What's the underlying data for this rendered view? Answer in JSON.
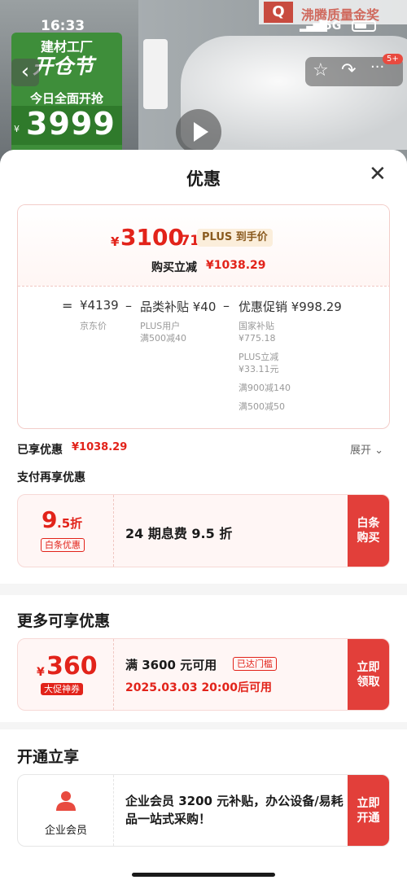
{
  "status_bar": {
    "time": "16:33",
    "network": "5G"
  },
  "promo": {
    "line1": "建材工厂",
    "line2": "开仓节",
    "line3": "今日全面开抢",
    "currency": "¥",
    "price": "3999"
  },
  "award": {
    "text": "沸腾质量金奖",
    "logo": "Q"
  },
  "top_icons": {
    "badge": "5+"
  },
  "sheet": {
    "title": "优惠"
  },
  "price_card": {
    "currency": "¥",
    "price_int": "3100",
    "price_dec": ".71",
    "plus_tag": "PLUS 到手价",
    "buy_reduce_label": "购买立减",
    "buy_reduce_value": "¥1038.29",
    "equals": "=",
    "minus": "–",
    "jd_price": "¥4139",
    "jd_price_label": "京东价",
    "category_subsidy": "品类补贴 ¥40",
    "category_sub1": "PLUS用户",
    "category_sub2": "满500减40",
    "promo_discount": "优惠促销 ¥998.29",
    "promo_sub1": "国家补贴",
    "promo_sub2": "¥775.18",
    "promo_sub3": "PLUS立减",
    "promo_sub4": "¥33.11元",
    "promo_sub5": "满900减140",
    "promo_sub6": "满500减50"
  },
  "enjoyed": {
    "label": "已享优惠",
    "value": "¥1038.29",
    "expand": "展开"
  },
  "pay_section": {
    "title": "支付再享优惠",
    "coupon": {
      "big": "9",
      "small": ".5折",
      "tag": "白条优惠",
      "desc": "24 期息费 9.5 折",
      "action": "白条购买"
    }
  },
  "more_section": {
    "title": "更多可享优惠",
    "coupon": {
      "currency": "¥",
      "amount": "360",
      "tag": "大促神券",
      "cond": "满 3600 元可用",
      "status": "已达门槛",
      "time": "2025.03.03 20:00后可用",
      "action": "立即领取"
    }
  },
  "open_section": {
    "title": "开通立享",
    "card": {
      "label": "企业会员",
      "desc": "企业会员 3200 元补贴，办公设备/易耗品一站式采购！",
      "action": "立即开通"
    }
  },
  "colors": {
    "accent_red": "#e2231a",
    "button_red": "#e23f3a",
    "plus_gold": "#8a5a1e",
    "promo_green": "#3e8e3a"
  }
}
